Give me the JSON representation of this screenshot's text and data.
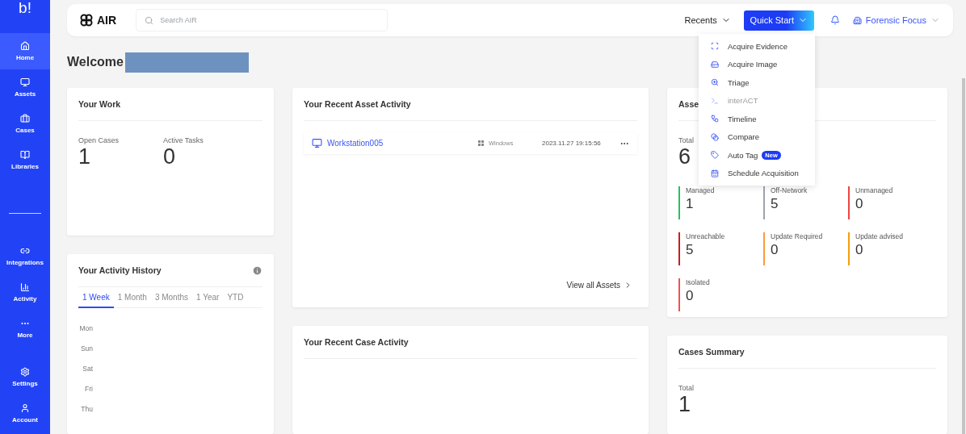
{
  "sidebar": {
    "logo": "b!",
    "groups": [
      [
        {
          "label": "Home",
          "selected": true
        },
        {
          "label": "Assets",
          "selected": false
        },
        {
          "label": "Cases",
          "selected": false
        },
        {
          "label": "Libraries",
          "selected": false
        }
      ],
      [
        {
          "label": "Integrations",
          "selected": false
        },
        {
          "label": "Activity",
          "selected": false
        },
        {
          "label": "More",
          "selected": false
        }
      ],
      [
        {
          "label": "Settings",
          "selected": false
        },
        {
          "label": "Account",
          "selected": false
        }
      ]
    ]
  },
  "topbar": {
    "app_name": "AIR",
    "search": {
      "placeholder": "Search AIR"
    },
    "recents": "Recents",
    "quick_start": "Quick Start",
    "organization": "Forensic Focus"
  },
  "quick_start_menu": {
    "items": [
      {
        "label": "Acquire Evidence",
        "disabled": false
      },
      {
        "label": "Acquire Image",
        "disabled": false
      },
      {
        "label": "Triage",
        "disabled": false
      },
      {
        "label": "interACT",
        "disabled": true
      },
      {
        "label": "Timeline",
        "disabled": false
      },
      {
        "label": "Compare",
        "disabled": false
      },
      {
        "label": "Auto Tag",
        "disabled": false,
        "badge": "New"
      },
      {
        "label": "Schedule Acquisition",
        "disabled": false
      }
    ]
  },
  "welcome": {
    "text": "Welcome",
    "redacted": true
  },
  "your_work": {
    "title": "Your Work",
    "stats": [
      {
        "label": "Open Cases",
        "value": "1"
      },
      {
        "label": "Active Tasks",
        "value": "0"
      }
    ]
  },
  "activity_history": {
    "title": "Your Activity History",
    "tabs": [
      {
        "label": "1 Week",
        "selected": true
      },
      {
        "label": "1 Month",
        "selected": false
      },
      {
        "label": "3 Months",
        "selected": false
      },
      {
        "label": "1 Year",
        "selected": false
      },
      {
        "label": "YTD",
        "selected": false
      }
    ],
    "days": [
      "Mon",
      "Sun",
      "Sat",
      "Fri",
      "Thu"
    ]
  },
  "recent_assets": {
    "title": "Your Recent Asset Activity",
    "rows": [
      {
        "name": "Workstation005",
        "os": "Windows",
        "time": "2023.11.27 19:15:56"
      }
    ],
    "link": "View all Assets"
  },
  "recent_cases": {
    "title": "Your Recent Case Activity"
  },
  "assets_summary": {
    "title": "Asse",
    "total_label": "Total",
    "total": "6",
    "statuses": [
      {
        "label": "Managed",
        "value": "1",
        "color": "#22c55e"
      },
      {
        "label": "Off-Network",
        "value": "5",
        "color": "#9ca3af"
      },
      {
        "label": "Unmanaged",
        "value": "0",
        "color": "#ef4444"
      },
      {
        "label": "Unreachable",
        "value": "5",
        "color": "#c81e1e"
      },
      {
        "label": "Update Required",
        "value": "0",
        "color": "#fb9a3c"
      },
      {
        "label": "Update advised",
        "value": "0",
        "color": "#f59e0b"
      },
      {
        "label": "Isolated",
        "value": "0",
        "color": "#f05252"
      }
    ]
  },
  "cases_summary": {
    "title": "Cases Summary",
    "total_label": "Total",
    "total": "1"
  }
}
